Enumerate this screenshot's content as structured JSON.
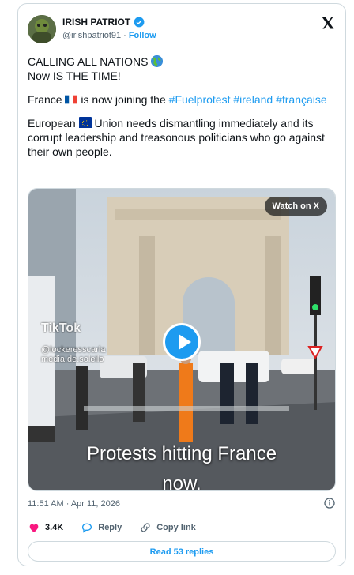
{
  "author": {
    "name": "IRISH PATRIOT",
    "handle": "@irishpatriot91",
    "separator": "·",
    "follow_label": "Follow"
  },
  "post": {
    "line1": "CALLING ALL NATIONS",
    "line2": "Now IS THE TIME!",
    "p2_prefix": "France",
    "p2_text": "is now joining the",
    "p2_tag1": "#Fuelprotest",
    "p2_tag2": "#ireland",
    "p2_tag3": "#française",
    "p3_prefix": "European",
    "p3_text": "Union needs dismantling immediately and its corrupt leadership and treasonous politicians who go against their own people."
  },
  "media": {
    "watch_label": "Watch on X",
    "tiktok_label": "TikTok",
    "tiktok_user1": "@lockeresscarla",
    "tiktok_user2": "media.de.soleilo",
    "caption_line1": "Protests hitting France",
    "caption_line2": "now."
  },
  "meta": {
    "timestamp": "11:51 AM · Apr 11, 2026"
  },
  "actions": {
    "likes": "3.4K",
    "reply": "Reply",
    "copy_link": "Copy link"
  },
  "read_replies": "Read 53 replies",
  "colors": {
    "accent": "#1d9bf0",
    "like": "#f91880",
    "muted": "#536471"
  }
}
